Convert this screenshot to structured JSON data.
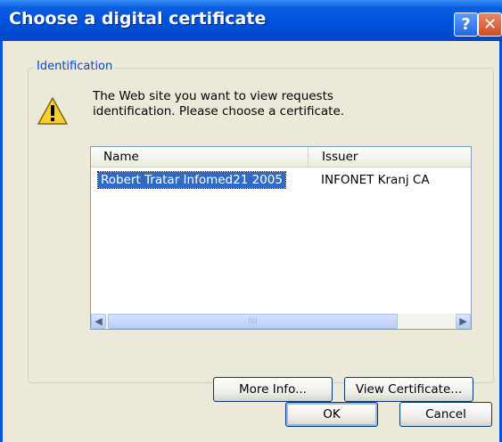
{
  "window": {
    "title": "Choose a digital certificate",
    "help_label": "?",
    "close_label": "✕"
  },
  "group": {
    "label": "Identification"
  },
  "message": {
    "line1": "The Web site you want to view requests",
    "line2": "identification. Please choose a certificate."
  },
  "list": {
    "columns": [
      "Name",
      "Issuer"
    ],
    "rows": [
      {
        "name": "Robert Tratar Infomed21 2005",
        "issuer": "INFONET Kranj CA",
        "selected": true
      }
    ]
  },
  "scrollbar": {
    "left_arrow": "◀",
    "right_arrow": "▶",
    "thumb_grip": "IIII"
  },
  "buttons": {
    "more_info": "More Info...",
    "view_certificate": "View Certificate...",
    "ok": "OK",
    "cancel": "Cancel"
  },
  "colors": {
    "titlebar": "#0054e3",
    "selection": "#316ac5",
    "group_label": "#0046d5",
    "dialog_bg": "#ece9d8"
  },
  "icons": {
    "warning": "warning-icon"
  }
}
